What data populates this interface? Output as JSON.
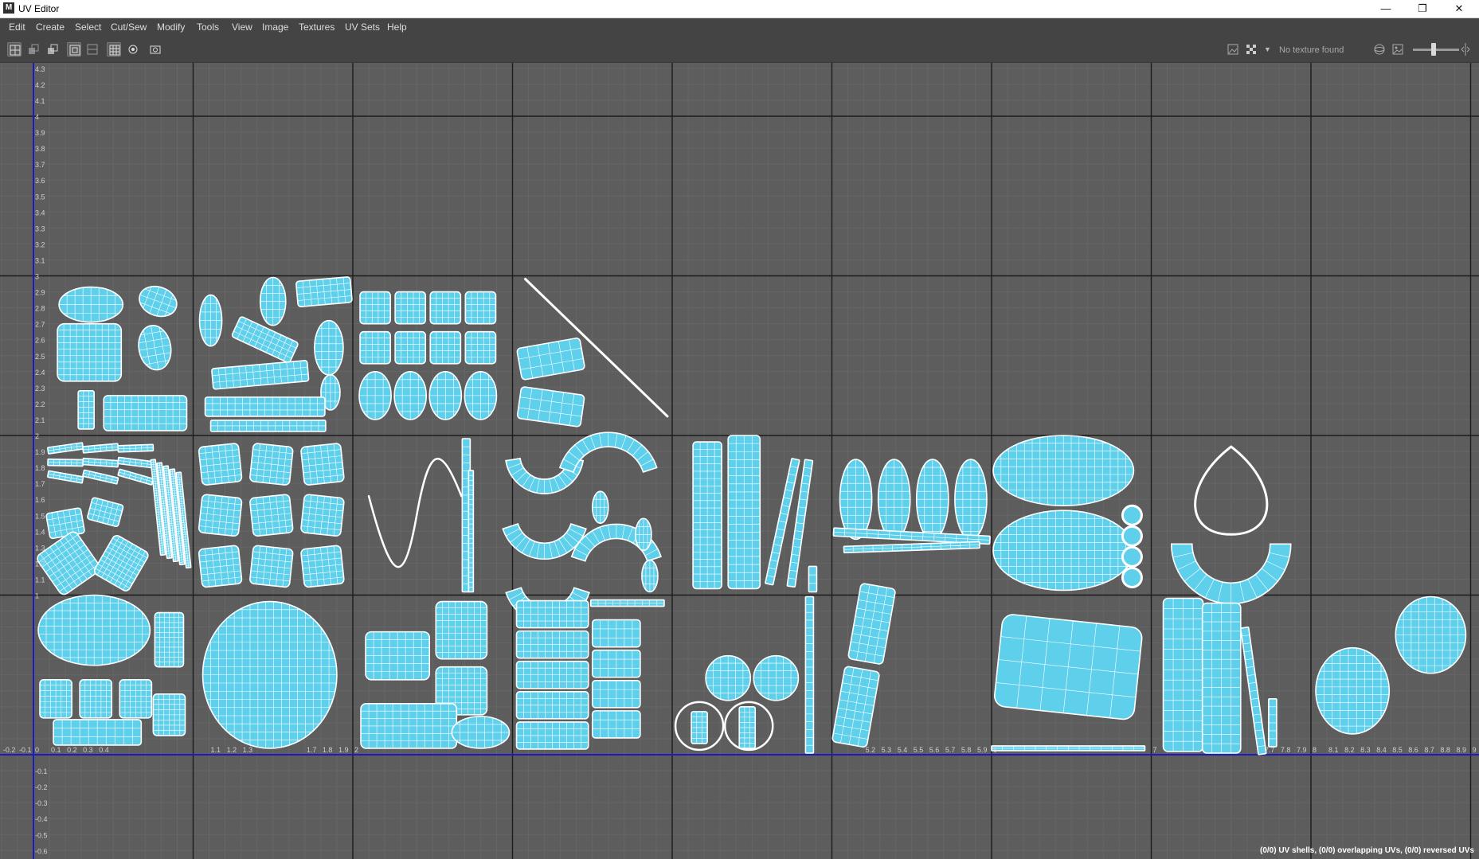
{
  "window": {
    "title": "UV Editor",
    "icon": "maya-app-icon",
    "controls": [
      "—",
      "❐",
      "✕"
    ]
  },
  "menu": [
    "Edit",
    "Create",
    "Select",
    "Cut/Sew",
    "Modify",
    "Tools",
    "View",
    "Image",
    "Textures",
    "UV Sets",
    "Help"
  ],
  "toolbar": {
    "left_tools": [
      "uv-select-icon",
      "vertex-select-icon",
      "face-select-icon",
      "shell-select-icon",
      "edge-select-icon",
      "grid-toggle-icon",
      "pixel-snap-icon",
      "snapshot-icon"
    ],
    "right_tools": [
      "image-display-icon",
      "checker-icon",
      "dropdown-icon"
    ],
    "texture_label": "No texture found",
    "end_tools": [
      "sphere-icon",
      "image-icon",
      "exposure-slider",
      "expand-icon"
    ]
  },
  "viewport": {
    "grid": {
      "u_range": [
        -0.2,
        9.0
      ],
      "v_range": [
        -0.7,
        4.3
      ],
      "major_step": 1,
      "minor_step": 0.1
    },
    "v_axis_labels": [
      "4.3",
      "4.2",
      "4.1",
      "4",
      "3.9",
      "3.8",
      "3.7",
      "3.6",
      "3.5",
      "3.4",
      "3.3",
      "3.2",
      "3.1",
      "3",
      "2.9",
      "2.8",
      "2.7",
      "2.6",
      "2.5",
      "2.4",
      "2.3",
      "2.2",
      "2.1",
      "2",
      "1.9",
      "1.8",
      "1.7",
      "1.6",
      "1.5",
      "1.4",
      "1.3",
      "1.2",
      "1.1",
      "1",
      "-0.1",
      "-0.2",
      "-0.3",
      "-0.4",
      "-0.5",
      "-0.6"
    ],
    "u_axis_labels": [
      "-0.2",
      "-0.1",
      "0",
      "0.1",
      "0.2",
      "0.3",
      "0.4",
      "1.1",
      "1.2",
      "1.3",
      "1.7",
      "1.8",
      "1.9",
      "2",
      "5.2",
      "5.3",
      "5.4",
      "5.5",
      "5.6",
      "5.7",
      "5.8",
      "5.9",
      "6",
      "7",
      "7.7",
      "7.8",
      "7.9",
      "8",
      "8.1",
      "8.2",
      "8.3",
      "8.4",
      "8.5",
      "8.6",
      "8.7",
      "8.8",
      "8.9",
      "9"
    ],
    "colors": {
      "background": "#5d5d5d",
      "minor_grid": "#666666",
      "major_grid": "#1c1c1c",
      "u_axis": "#1b1bbe",
      "v_axis": "#1b1bbe",
      "uv_shell_fill": "#5fd0ec",
      "uv_wire": "#ffffff"
    }
  },
  "status": {
    "text": "(0/0) UV shells, (0/0) overlapping UVs, (0/0) reversed UVs"
  }
}
